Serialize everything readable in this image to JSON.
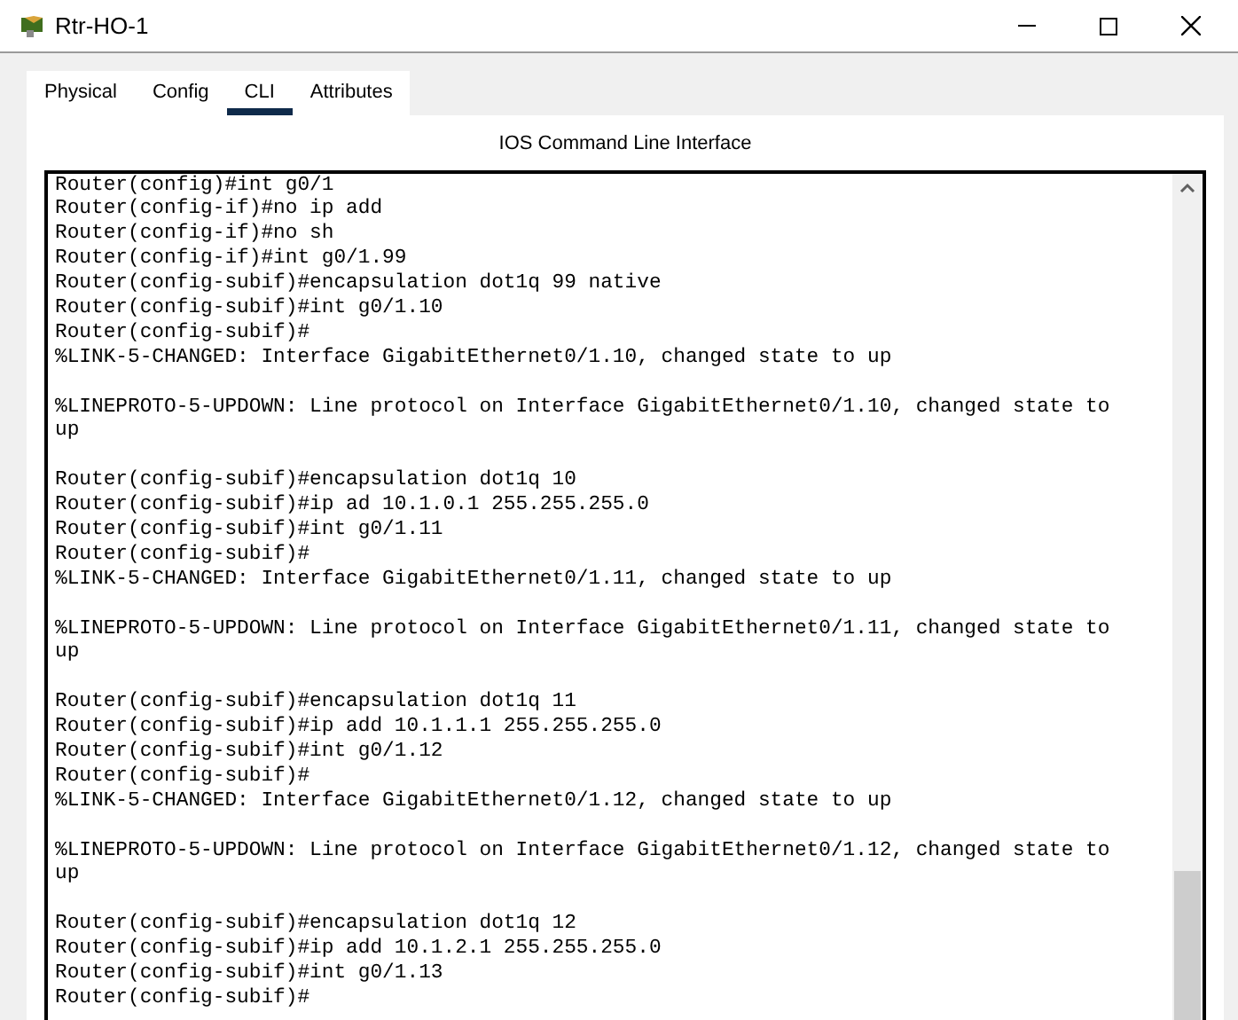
{
  "window": {
    "title": "Rtr-HO-1"
  },
  "tabs": [
    {
      "label": "Physical",
      "selected": false
    },
    {
      "label": "Config",
      "selected": false
    },
    {
      "label": "CLI",
      "selected": true
    },
    {
      "label": "Attributes",
      "selected": false
    }
  ],
  "panel_title": "IOS Command Line Interface",
  "output_blocks": [
    {
      "lines": [
        "Router(config)#int g0/1",
        "Router(config-if)#no ip add",
        "Router(config-if)#no sh",
        "Router(config-if)#int g0/1.99",
        "Router(config-subif)#encapsulation dot1q 99 native",
        "Router(config-subif)#int g0/1.10",
        "Router(config-subif)#",
        "%LINK-5-CHANGED: Interface GigabitEthernet0/1.10, changed state to up"
      ]
    },
    {
      "lines": [
        "%LINEPROTO-5-UPDOWN: Line protocol on Interface GigabitEthernet0/1.10, changed state to",
        "up"
      ]
    },
    {
      "lines": [
        "Router(config-subif)#encapsulation dot1q 10",
        "Router(config-subif)#ip ad 10.1.0.1 255.255.255.0",
        "Router(config-subif)#int g0/1.11",
        "Router(config-subif)#",
        "%LINK-5-CHANGED: Interface GigabitEthernet0/1.11, changed state to up"
      ]
    },
    {
      "lines": [
        "%LINEPROTO-5-UPDOWN: Line protocol on Interface GigabitEthernet0/1.11, changed state to",
        "up"
      ]
    },
    {
      "lines": [
        "Router(config-subif)#encapsulation dot1q 11",
        "Router(config-subif)#ip add 10.1.1.1 255.255.255.0",
        "Router(config-subif)#int g0/1.12",
        "Router(config-subif)#",
        "%LINK-5-CHANGED: Interface GigabitEthernet0/1.12, changed state to up"
      ]
    },
    {
      "lines": [
        "%LINEPROTO-5-UPDOWN: Line protocol on Interface GigabitEthernet0/1.12, changed state to",
        "up"
      ]
    },
    {
      "lines": [
        "Router(config-subif)#encapsulation dot1q 12",
        "Router(config-subif)#ip add 10.1.2.1 255.255.255.0",
        "Router(config-subif)#int g0/1.13",
        "Router(config-subif)#"
      ]
    }
  ]
}
